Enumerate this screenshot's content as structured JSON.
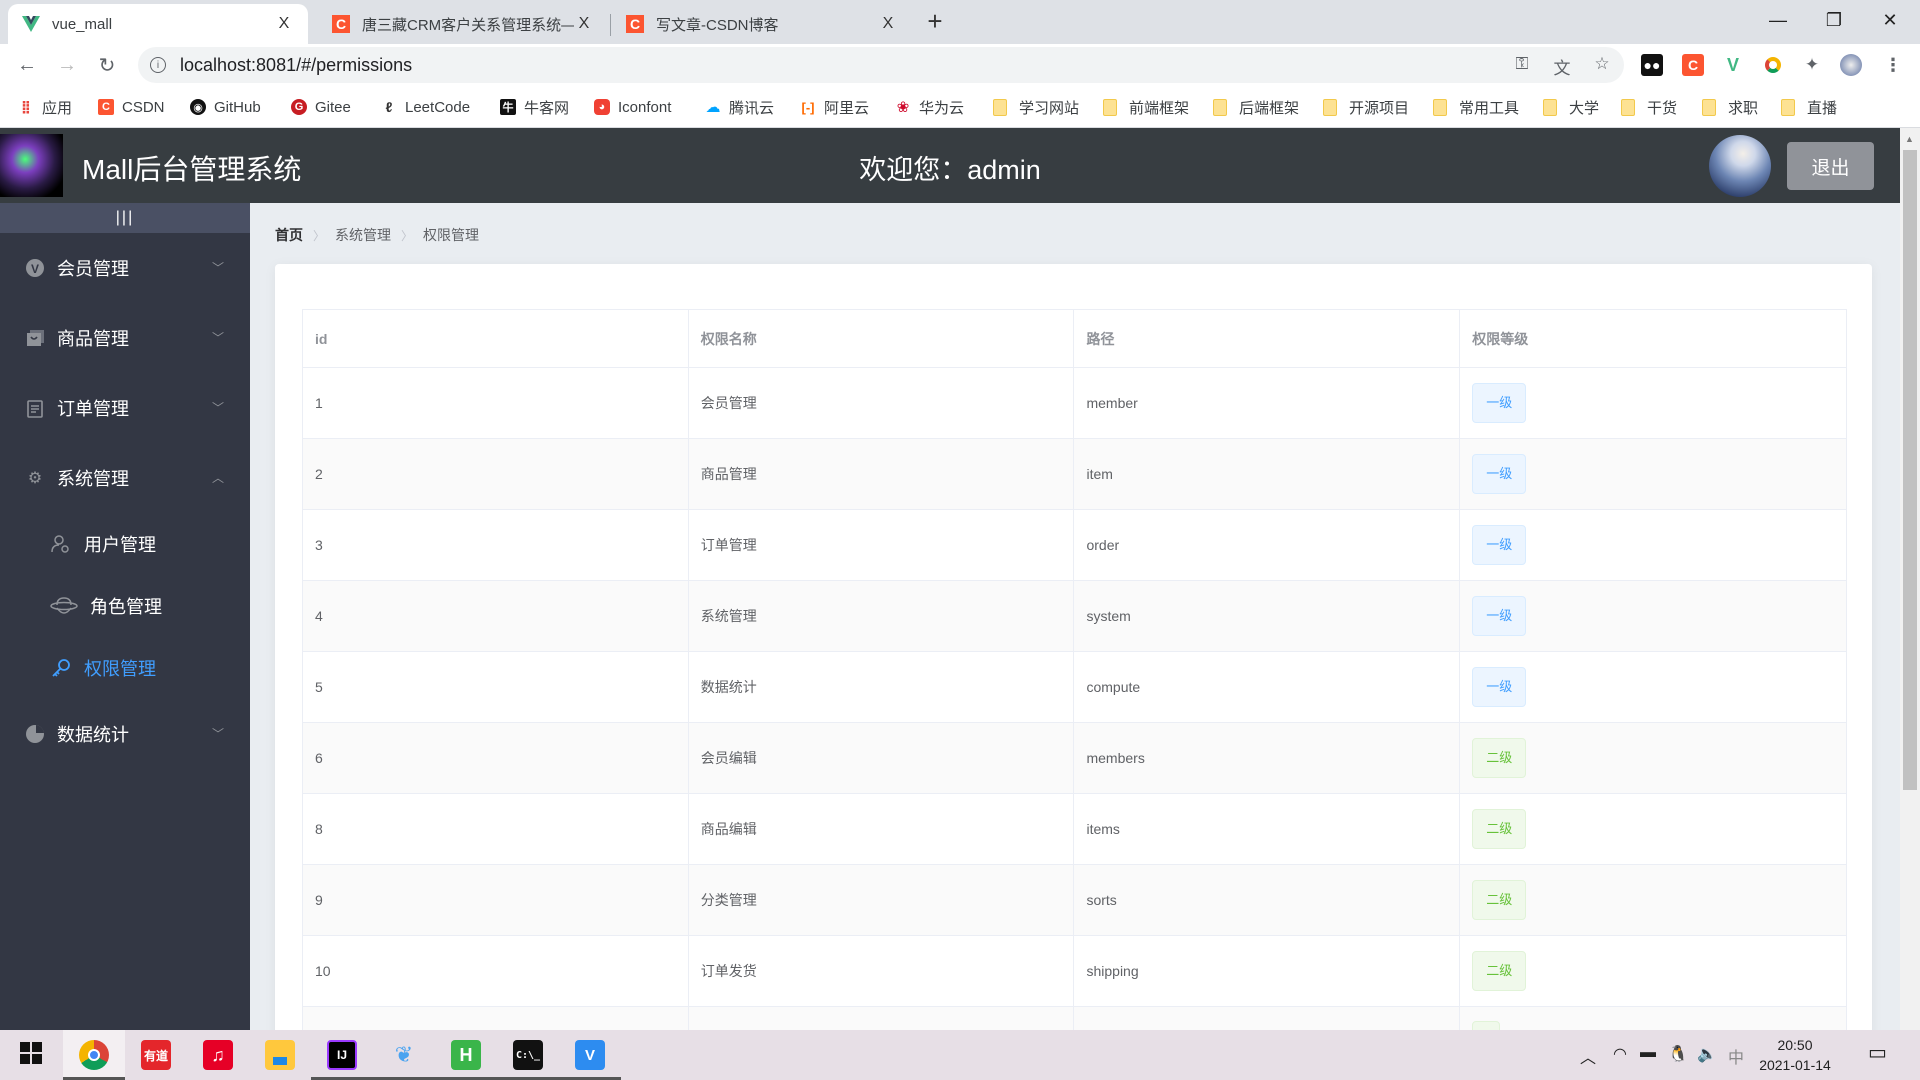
{
  "browser": {
    "tabs": [
      {
        "title": "vue_mall",
        "icon": "vue-logo-icon",
        "active": true
      },
      {
        "title": "唐三藏CRM客户关系管理系统—",
        "icon": "csdn-icon",
        "active": false
      },
      {
        "title": "写文章-CSDN博客",
        "icon": "csdn-icon",
        "active": false
      }
    ],
    "close_glyph": "X",
    "new_tab_glyph": "+",
    "url": "localhost:8081/#/permissions",
    "bookmarks": [
      {
        "label": "应用",
        "icon": "apps-grid-icon"
      },
      {
        "label": "CSDN",
        "icon": "csdn-icon"
      },
      {
        "label": "GitHub",
        "icon": "github-icon"
      },
      {
        "label": "Gitee",
        "icon": "gitee-icon"
      },
      {
        "label": "LeetCode",
        "icon": "leetcode-icon"
      },
      {
        "label": "牛客网",
        "icon": "nowcoder-icon"
      },
      {
        "label": "Iconfont",
        "icon": "iconfont-icon"
      },
      {
        "label": "腾讯云",
        "icon": "tencent-cloud-icon"
      },
      {
        "label": "阿里云",
        "icon": "aliyun-icon"
      },
      {
        "label": "华为云",
        "icon": "huawei-cloud-icon"
      },
      {
        "label": "学习网站",
        "icon": "folder-icon"
      },
      {
        "label": "前端框架",
        "icon": "folder-icon"
      },
      {
        "label": "后端框架",
        "icon": "folder-icon"
      },
      {
        "label": "开源项目",
        "icon": "folder-icon"
      },
      {
        "label": "常用工具",
        "icon": "folder-icon"
      },
      {
        "label": "大学",
        "icon": "folder-icon"
      },
      {
        "label": "干货",
        "icon": "folder-icon"
      },
      {
        "label": "求职",
        "icon": "folder-icon"
      },
      {
        "label": "直播",
        "icon": "folder-icon"
      }
    ]
  },
  "header": {
    "title": "Mall后台管理系统",
    "welcome": "欢迎您：admin",
    "logout_label": "退出"
  },
  "sidebar": {
    "toggle_label": "|||",
    "menus": [
      {
        "label": "会员管理",
        "icon": "member-icon",
        "expanded": false
      },
      {
        "label": "商品管理",
        "icon": "shopping-bag-icon",
        "expanded": false
      },
      {
        "label": "订单管理",
        "icon": "order-icon",
        "expanded": false
      },
      {
        "label": "系统管理",
        "icon": "settings-icon",
        "expanded": true
      },
      {
        "label": "数据统计",
        "icon": "pie-chart-icon",
        "expanded": false
      }
    ],
    "submenus": [
      {
        "label": "用户管理",
        "icon": "user-settings-icon",
        "active": false
      },
      {
        "label": "角色管理",
        "icon": "role-hat-icon",
        "active": false
      },
      {
        "label": "权限管理",
        "icon": "key-icon",
        "active": true
      }
    ]
  },
  "breadcrumb": [
    "首页",
    "系统管理",
    "权限管理"
  ],
  "table": {
    "columns": [
      "id",
      "权限名称",
      "路径",
      "权限等级"
    ],
    "rows": [
      {
        "id": "1",
        "name": "会员管理",
        "path": "member",
        "level": "一级",
        "level_type": "l1"
      },
      {
        "id": "2",
        "name": "商品管理",
        "path": "item",
        "level": "一级",
        "level_type": "l1"
      },
      {
        "id": "3",
        "name": "订单管理",
        "path": "order",
        "level": "一级",
        "level_type": "l1"
      },
      {
        "id": "4",
        "name": "系统管理",
        "path": "system",
        "level": "一级",
        "level_type": "l1"
      },
      {
        "id": "5",
        "name": "数据统计",
        "path": "compute",
        "level": "一级",
        "level_type": "l1"
      },
      {
        "id": "6",
        "name": "会员编辑",
        "path": "members",
        "level": "二级",
        "level_type": "l2"
      },
      {
        "id": "8",
        "name": "商品编辑",
        "path": "items",
        "level": "二级",
        "level_type": "l2"
      },
      {
        "id": "9",
        "name": "分类管理",
        "path": "sorts",
        "level": "二级",
        "level_type": "l2"
      },
      {
        "id": "10",
        "name": "订单发货",
        "path": "shipping",
        "level": "二级",
        "level_type": "l2"
      },
      {
        "id": "",
        "name": "",
        "path": "",
        "level": "",
        "level_type": "l2"
      }
    ]
  },
  "colors": {
    "header_bg": "#373d41",
    "sidebar_bg": "#333744",
    "active_menu": "#409eff",
    "level1_tag": "#409eff",
    "level2_tag": "#67c23a",
    "logout_bg": "#909399"
  },
  "taskbar": {
    "apps": [
      "windows-start-icon",
      "chrome-icon",
      "youdao-icon",
      "netease-music-icon",
      "file-explorer-icon",
      "intellij-icon",
      "navicat-icon",
      "hbuilder-icon",
      "terminal-icon",
      "vscode-icon"
    ],
    "time": "20:50",
    "date": "2021-01-14",
    "ime": "中"
  }
}
